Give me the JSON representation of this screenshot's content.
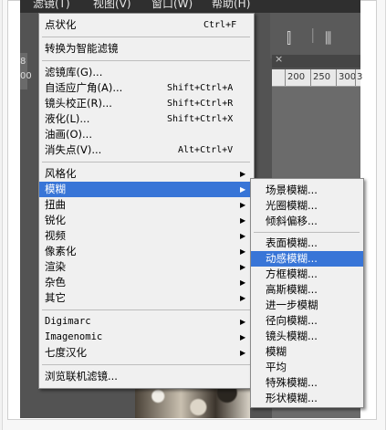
{
  "menubar": [
    "滤镜(T)",
    "视图(V)",
    "窗口(W)",
    "帮助(H)"
  ],
  "left_strip": [
    "8",
    "00"
  ],
  "tab_symbol": "×",
  "ruler_ticks": [
    "200",
    "250",
    "300",
    "3"
  ],
  "filter_menu": {
    "last_filter": {
      "label": "点状化",
      "shortcut": "Ctrl+F"
    },
    "convert_smart": "转换为智能滤镜",
    "filter_gallery": "滤镜库(G)...",
    "adaptive_wide_angle": {
      "label": "自适应广角(A)...",
      "shortcut": "Shift+Ctrl+A"
    },
    "lens_correction": {
      "label": "镜头校正(R)...",
      "shortcut": "Shift+Ctrl+R"
    },
    "liquify": {
      "label": "液化(L)...",
      "shortcut": "Shift+Ctrl+X"
    },
    "oil_paint": "油画(O)...",
    "vanishing_point": {
      "label": "消失点(V)...",
      "shortcut": "Alt+Ctrl+V"
    },
    "groups": [
      "风格化",
      "模糊",
      "扭曲",
      "锐化",
      "视频",
      "像素化",
      "渲染",
      "杂色",
      "其它"
    ],
    "plugins": [
      "Digimarc",
      "Imagenomic",
      "七度汉化"
    ],
    "browse_online": "浏览联机滤镜..."
  },
  "blur_submenu": [
    "场景模糊...",
    "光圈模糊...",
    "倾斜偏移...",
    "表面模糊...",
    "动感模糊...",
    "方框模糊...",
    "高斯模糊...",
    "进一步模糊",
    "径向模糊...",
    "镜头模糊...",
    "模糊",
    "平均",
    "特殊模糊...",
    "形状模糊..."
  ],
  "colors": {
    "highlight": "#3875d7",
    "menu_bg": "#f0f0f0",
    "app_bg": "#535353"
  }
}
